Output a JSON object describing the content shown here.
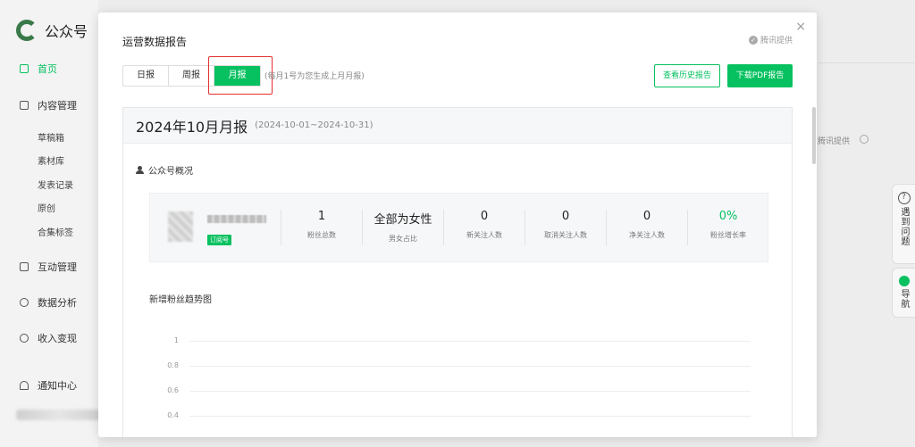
{
  "app": {
    "name": "公众号"
  },
  "sidebar": {
    "items": [
      {
        "label": "首页",
        "icon": "home-icon"
      },
      {
        "label": "内容管理",
        "icon": "document-icon"
      },
      {
        "label": "互动管理",
        "icon": "chat-icon"
      },
      {
        "label": "数据分析",
        "icon": "chart-icon"
      },
      {
        "label": "收入变现",
        "icon": "money-icon"
      },
      {
        "label": "通知中心",
        "icon": "bell-icon"
      }
    ],
    "subitems": [
      "草稿箱",
      "素材库",
      "发表记录",
      "原创",
      "合集标签"
    ]
  },
  "background": {
    "provider_text": "腾讯提供"
  },
  "side_tabs": {
    "help": "遇到问题",
    "guide": "导航"
  },
  "modal": {
    "title": "运营数据报告",
    "close": "×",
    "provider": "腾讯提供",
    "tabs": [
      "日报",
      "周报",
      "月报"
    ],
    "active_tab": "月报",
    "hint": "(每月1号为您生成上月月报)",
    "history_button": "查看历史报告",
    "download_button": "下载PDF报告",
    "report": {
      "title": "2024年10月月报",
      "range": "(2024-10-01~2024-10-31)",
      "overview_title": "公众号概况",
      "account_type": "订阅号",
      "stats": [
        {
          "value": "1",
          "label": "粉丝总数"
        },
        {
          "value": "全部为女性",
          "label": "男女占比"
        },
        {
          "value": "0",
          "label": "新关注人数"
        },
        {
          "value": "0",
          "label": "取消关注人数"
        },
        {
          "value": "0",
          "label": "净关注人数"
        },
        {
          "value": "0%",
          "label": "粉丝增长率"
        }
      ],
      "trend_title": "新增粉丝趋势图"
    }
  },
  "chart_data": {
    "type": "line",
    "title": "新增粉丝趋势图",
    "y_ticks": [
      "1",
      "0.8",
      "0.6",
      "0.4"
    ],
    "series": []
  },
  "colors": {
    "accent": "#07c160",
    "highlight": "#e53030"
  }
}
